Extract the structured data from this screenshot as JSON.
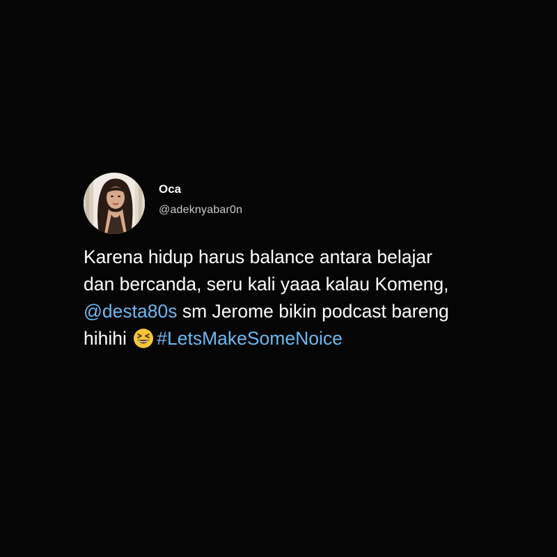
{
  "tweet": {
    "author": {
      "display_name": "Oca",
      "handle": "@adeknyabar0n",
      "avatar_icon": "profile-photo-avatar"
    },
    "text": {
      "line1": "Karena hidup harus balance antara belajar",
      "line2": "dan bercanda, seru kali yaaa kalau Komeng,",
      "line3_mention": "@desta80s",
      "line3_rest": " sm Jerome bikin podcast bareng",
      "line4_text": "hihihi ",
      "line4_emoji_icon": "grinning-squinting-face-emoji",
      "line4_hashtag": "#LetsMakeSomeNoice"
    },
    "colors": {
      "background": "#050505",
      "text": "#ffffff",
      "handle": "#c9cccf",
      "link": "#6cb8f2"
    }
  }
}
